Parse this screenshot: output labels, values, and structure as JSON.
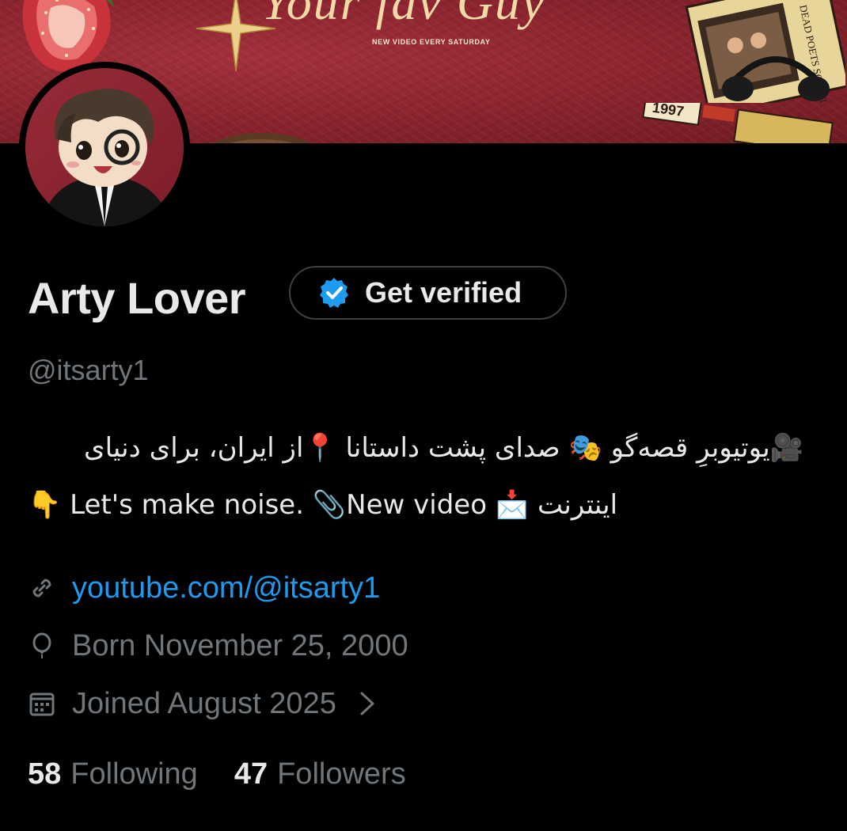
{
  "banner": {
    "script_title": "Your fav Guy",
    "tagline": "NEW VIDEO EVERY SATURDAY",
    "sticker_year": "1997",
    "book_title": "DEAD POETS SOCIETY"
  },
  "profile": {
    "name": "Arty Lover",
    "handle": "@itsarty1",
    "verify_button_label": "Get verified",
    "verify_icon": "verified-badge-icon",
    "bio": {
      "line1": "🎥یوتیوبرِ قصه‌گو 🎭 صدای پشت داستانا 📍از ایران، برای دنیای",
      "line2_rtl": "اینترنت",
      "line2_ltr": "New video",
      "line2_tail": "Let's make noise.",
      "emoji_icons": [
        "movie-camera-icon",
        "theater-masks-icon",
        "pin-icon",
        "incoming-envelope-icon",
        "paperclip-icon",
        "point-down-icon"
      ]
    },
    "website": "youtube.com/@itsarty1",
    "birthday": "Born November 25, 2000",
    "joined": "Joined August 2025",
    "following_count": "58",
    "following_label": "Following",
    "followers_count": "47",
    "followers_label": "Followers"
  },
  "colors": {
    "background": "#000000",
    "primary_text": "#e7e9ea",
    "secondary_text": "#71767b",
    "link": "#1d9bf0",
    "banner_red": "#8e2530"
  }
}
